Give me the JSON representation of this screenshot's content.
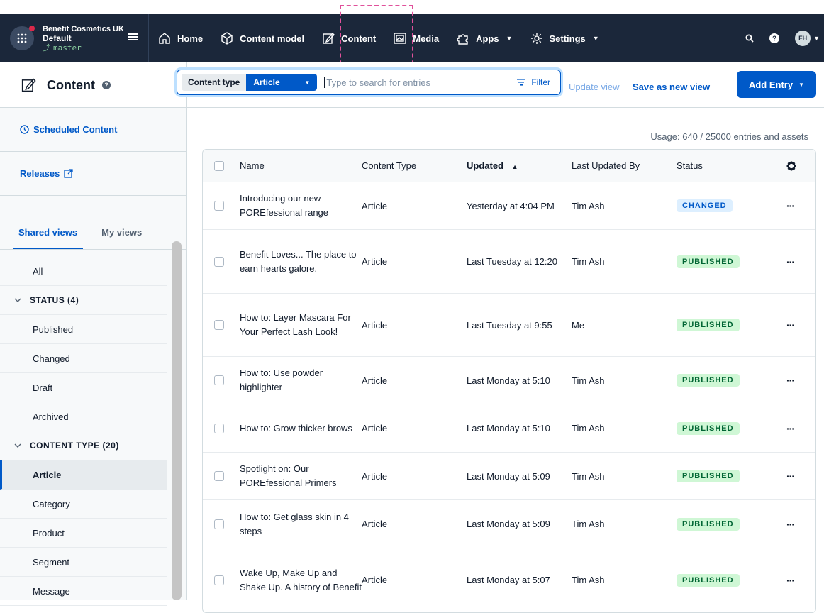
{
  "space": {
    "name": "Benefit Cosmetics UK",
    "environment": "Default",
    "branch": "master"
  },
  "nav": {
    "items": [
      {
        "label": "Home",
        "icon": "home-icon"
      },
      {
        "label": "Content model",
        "icon": "cube-icon"
      },
      {
        "label": "Content",
        "icon": "edit-icon"
      },
      {
        "label": "Media",
        "icon": "image-icon"
      },
      {
        "label": "Apps",
        "icon": "puzzle-icon"
      },
      {
        "label": "Settings",
        "icon": "gear-icon"
      }
    ],
    "avatar_initials": "FH"
  },
  "header": {
    "title": "Content",
    "content_type_label": "Content type",
    "content_type_value": "Article",
    "search_placeholder": "Type to search for entries",
    "filter_label": "Filter",
    "update_view": "Update view",
    "save_view": "Save as new view",
    "add_entry": "Add Entry"
  },
  "sidebar": {
    "scheduled": "Scheduled Content",
    "releases": "Releases",
    "tabs": [
      "Shared views",
      "My views"
    ],
    "views": [
      {
        "label": "All",
        "kind": "item"
      },
      {
        "label": "STATUS (4)",
        "kind": "group"
      },
      {
        "label": "Published",
        "kind": "item"
      },
      {
        "label": "Changed",
        "kind": "item"
      },
      {
        "label": "Draft",
        "kind": "item"
      },
      {
        "label": "Archived",
        "kind": "item"
      },
      {
        "label": "CONTENT TYPE (20)",
        "kind": "group"
      },
      {
        "label": "Article",
        "kind": "item",
        "active": true
      },
      {
        "label": "Category",
        "kind": "item"
      },
      {
        "label": "Product",
        "kind": "item"
      },
      {
        "label": "Segment",
        "kind": "item"
      },
      {
        "label": "Message",
        "kind": "item"
      }
    ]
  },
  "usage": "Usage: 640 / 25000 entries and assets",
  "table": {
    "columns": [
      "Name",
      "Content Type",
      "Updated",
      "Last Updated By",
      "Status"
    ],
    "rows": [
      {
        "name": "Introducing our new POREfessional range",
        "type": "Article",
        "updated": "Yesterday at 4:04 PM",
        "by": "Tim Ash",
        "status": "CHANGED",
        "height": 67
      },
      {
        "name": "Benefit Loves... The place to earn hearts galore.",
        "type": "Article",
        "updated": "Last Tuesday at 12:20",
        "by": "Tim Ash",
        "status": "PUBLISHED",
        "height": 90
      },
      {
        "name": "How to: Layer Mascara For Your Perfect Lash Look!",
        "type": "Article",
        "updated": "Last Tuesday at 9:55",
        "by": "Me",
        "status": "PUBLISHED",
        "height": 89
      },
      {
        "name": "How to: Use powder highlighter",
        "type": "Article",
        "updated": "Last Monday at 5:10",
        "by": "Tim Ash",
        "status": "PUBLISHED",
        "height": 67
      },
      {
        "name": "How to: Grow thicker brows",
        "type": "Article",
        "updated": "Last Monday at 5:10",
        "by": "Tim Ash",
        "status": "PUBLISHED",
        "height": 68
      },
      {
        "name": "Spotlight on: Our POREfessional Primers",
        "type": "Article",
        "updated": "Last Monday at 5:09",
        "by": "Tim Ash",
        "status": "PUBLISHED",
        "height": 67
      },
      {
        "name": "How to: Get glass skin in 4 steps",
        "type": "Article",
        "updated": "Last Monday at 5:09",
        "by": "Tim Ash",
        "status": "PUBLISHED",
        "height": 68
      },
      {
        "name": "Wake Up, Make Up and Shake Up. A history of Benefit",
        "type": "Article",
        "updated": "Last Monday at 5:07",
        "by": "Tim Ash",
        "status": "PUBLISHED",
        "height": 90
      }
    ]
  }
}
